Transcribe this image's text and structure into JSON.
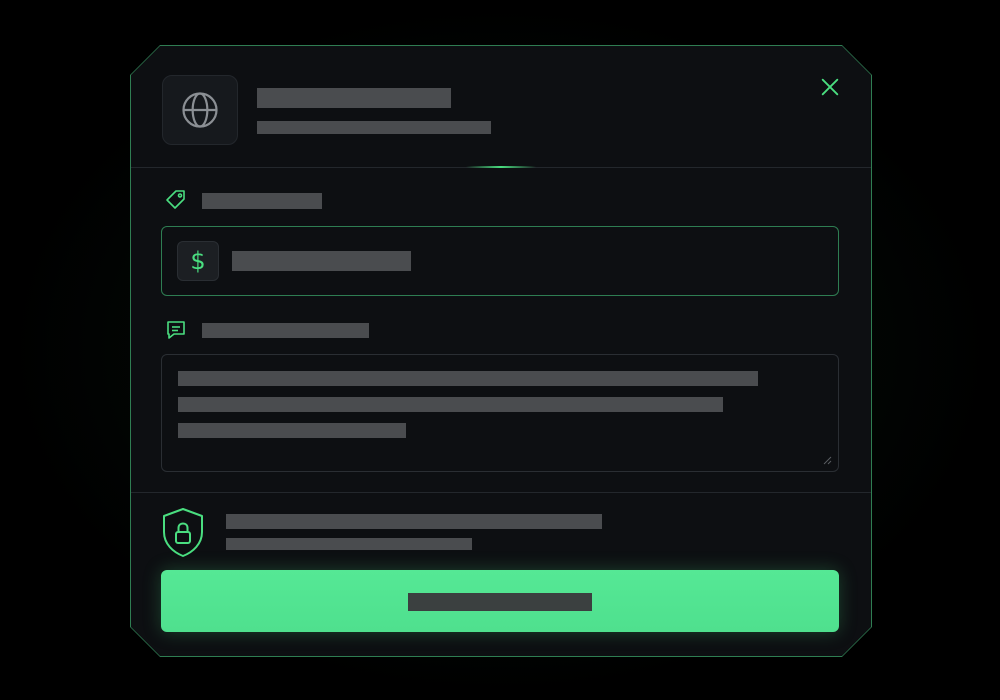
{
  "colors": {
    "accent": "#4ade80",
    "panel": "#0d0f12",
    "placeholder_bar": "#4a4c4f",
    "border": "#23272c"
  },
  "header": {
    "icon": "globe-icon",
    "close_icon": "close-icon"
  },
  "amount_field": {
    "label_icon": "tag-icon",
    "currency_icon": "dollar-sign-icon",
    "currency_symbol": "$"
  },
  "message_field": {
    "label_icon": "chat-bubble-icon",
    "resize_icon": "resize-handle-icon"
  },
  "security": {
    "icon": "shield-lock-icon"
  },
  "submit": {
    "icon": "none"
  }
}
